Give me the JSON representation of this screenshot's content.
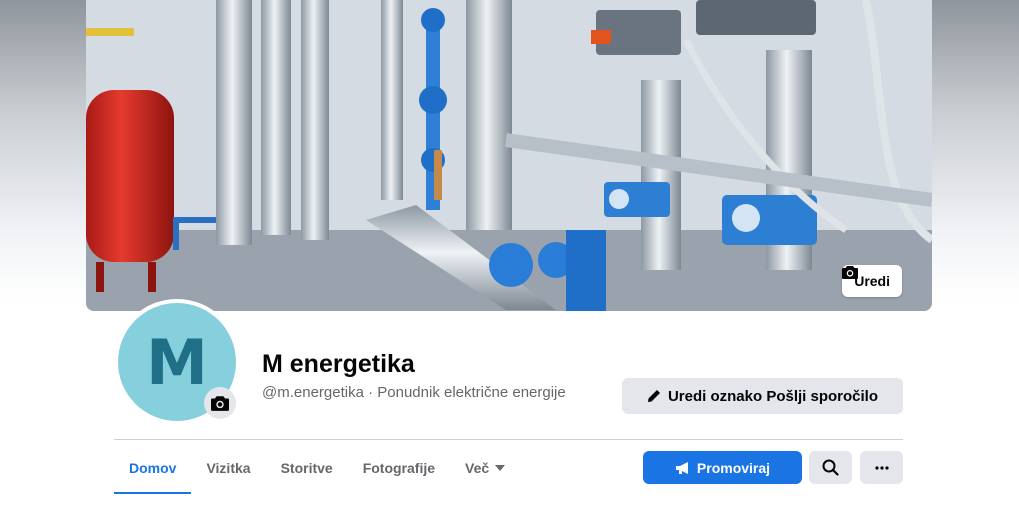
{
  "cover": {
    "edit_label": "Uredi",
    "edit_icon": "camera-icon"
  },
  "profile": {
    "avatar_letter": "M",
    "avatar_color": "#86cfdc",
    "name": "M energetika",
    "subtitle": "@m.energetika · Ponudnik električne energije"
  },
  "actions": {
    "edit_label": "Uredi oznako Pošlji sporočilo",
    "edit_icon": "pencil-icon"
  },
  "tabs": [
    {
      "label": "Domov",
      "active": true
    },
    {
      "label": "Vizitka"
    },
    {
      "label": "Storitve"
    },
    {
      "label": "Fotografije"
    },
    {
      "label": "Več",
      "dropdown": true
    }
  ],
  "toolbar": {
    "promote_label": "Promoviraj",
    "promote_icon": "megaphone-icon",
    "search_icon": "search-icon",
    "more_icon": "more-icon"
  },
  "colors": {
    "accent": "#1b74e4",
    "secondary_button": "#e4e6eb",
    "text": "#050505",
    "muted": "#65676b"
  }
}
